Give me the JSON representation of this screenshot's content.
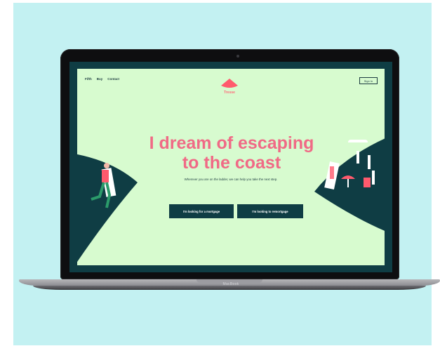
{
  "page": {
    "brand_label": "MacBook"
  },
  "site": {
    "nav": [
      "Fifth",
      "Buy",
      "Contact"
    ],
    "logo_text": "Tresse",
    "signin_label": "Sign In",
    "headline_line1": "I dream of escaping",
    "headline_line2": "to the coast",
    "subtitle": "Wherever you are on the ladder, we can help you take the next step.",
    "buttons": {
      "mortgage": "I'm looking for a mortgage",
      "remortgage": "I'm looking to remortgage"
    }
  },
  "colors": {
    "background": "#c3f1f2",
    "page_bg": "#d7fbcf",
    "dark_teal": "#0f3d44",
    "coral": "#f06a86"
  }
}
